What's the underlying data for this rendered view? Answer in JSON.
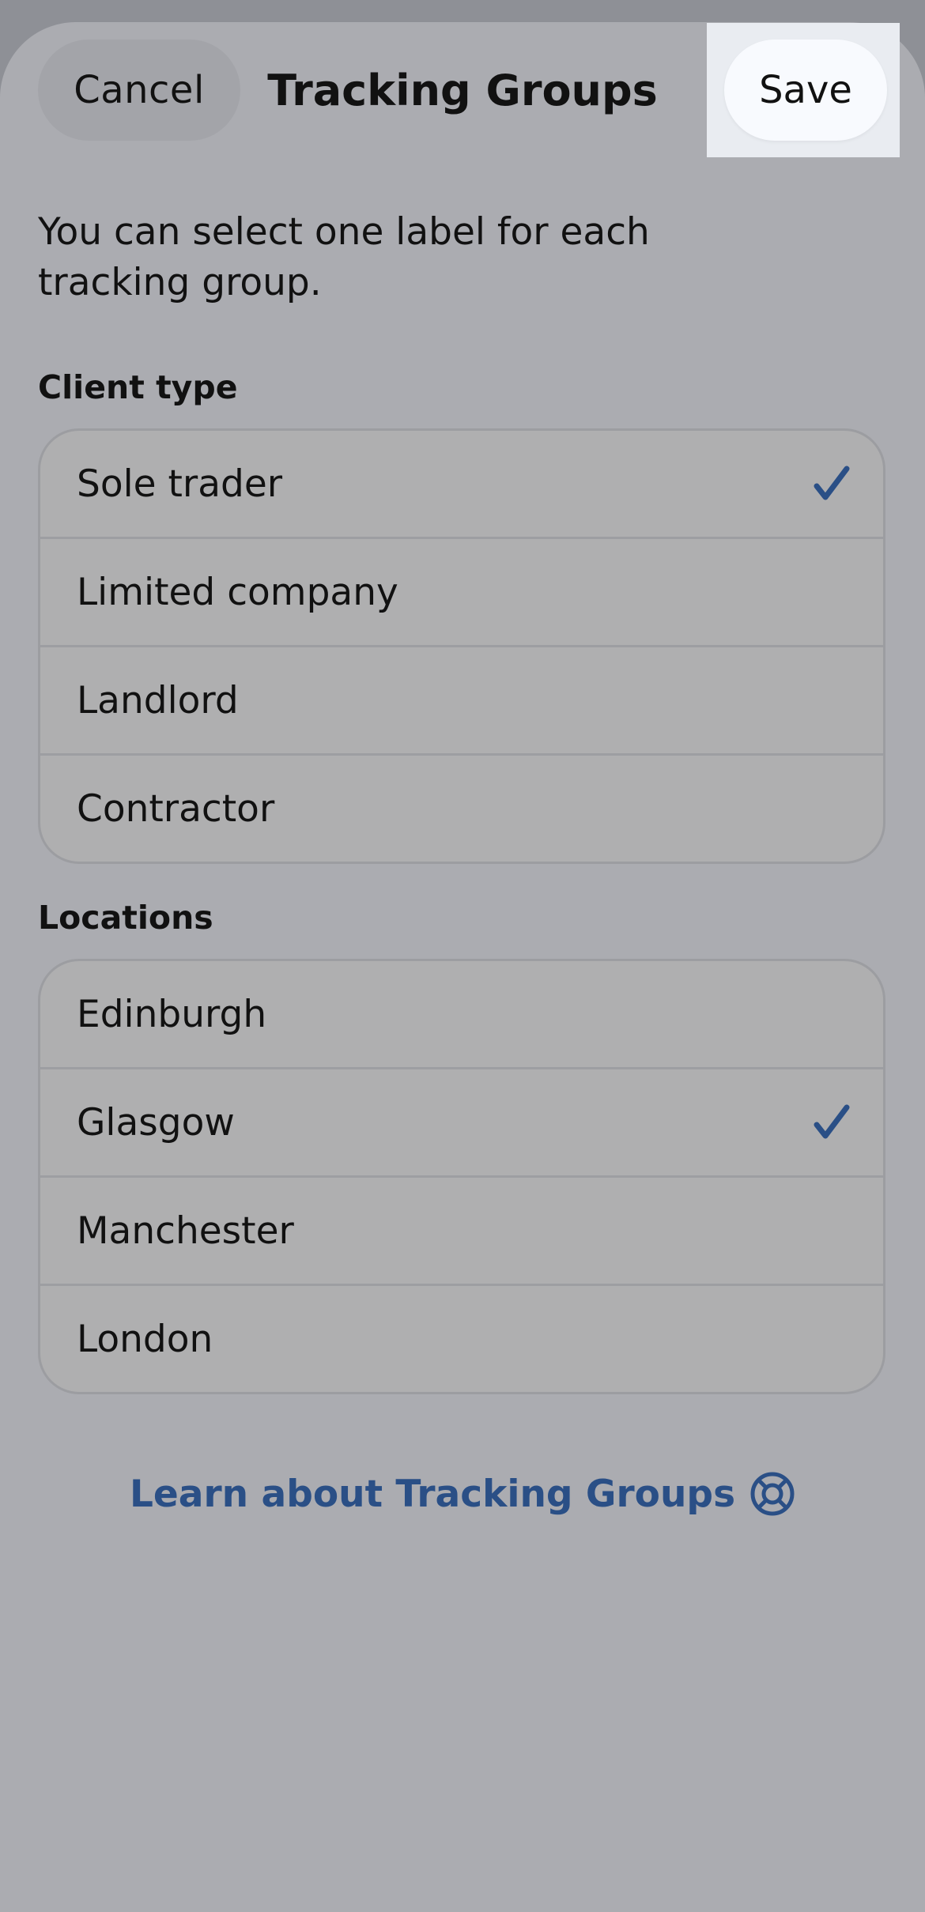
{
  "header": {
    "cancel_label": "Cancel",
    "title": "Tracking Groups",
    "save_label": "Save"
  },
  "intro": "You can select one label for each tracking group.",
  "groups": [
    {
      "label": "Client type",
      "options": [
        {
          "label": "Sole trader",
          "selected": true
        },
        {
          "label": "Limited company",
          "selected": false
        },
        {
          "label": "Landlord",
          "selected": false
        },
        {
          "label": "Contractor",
          "selected": false
        }
      ]
    },
    {
      "label": "Locations",
      "options": [
        {
          "label": "Edinburgh",
          "selected": false
        },
        {
          "label": "Glasgow",
          "selected": true
        },
        {
          "label": "Manchester",
          "selected": false
        },
        {
          "label": "London",
          "selected": false
        }
      ]
    }
  ],
  "learn_link": {
    "label": "Learn about Tracking Groups",
    "icon": "lifebuoy-icon"
  },
  "colors": {
    "accent": "#2a4f86",
    "overlay": "#abacb1",
    "save_bg": "#f8fafe"
  }
}
